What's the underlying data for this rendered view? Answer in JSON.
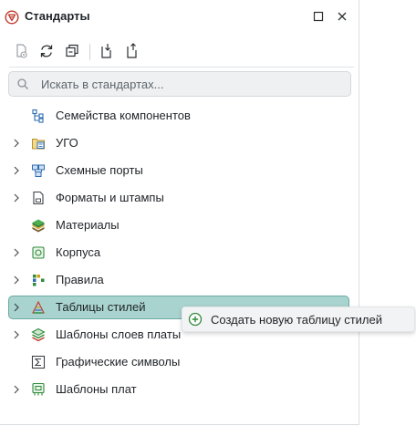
{
  "panel": {
    "title": "Стандарты",
    "icon": "standards-logo-icon"
  },
  "toolbar": {
    "buttons": [
      {
        "name": "document-settings-icon"
      },
      {
        "name": "refresh-icon"
      },
      {
        "name": "collapse-all-icon"
      },
      {
        "name": "import-icon"
      },
      {
        "name": "export-icon"
      }
    ]
  },
  "search": {
    "placeholder": "Искать в стандартах...",
    "value": ""
  },
  "tree": {
    "items": [
      {
        "label": "Семейства компонентов",
        "icon": "component-family-icon",
        "expandable": false
      },
      {
        "label": "УГО",
        "icon": "symbols-icon",
        "expandable": true
      },
      {
        "label": "Схемные порты",
        "icon": "schematic-ports-icon",
        "expandable": true
      },
      {
        "label": "Форматы и штампы",
        "icon": "sheet-formats-icon",
        "expandable": true
      },
      {
        "label": "Материалы",
        "icon": "materials-icon",
        "expandable": false
      },
      {
        "label": "Корпуса",
        "icon": "packages-icon",
        "expandable": true
      },
      {
        "label": "Правила",
        "icon": "rules-icon",
        "expandable": true
      },
      {
        "label": "Таблицы стилей",
        "icon": "style-tables-icon",
        "expandable": true,
        "selected": true
      },
      {
        "label": "Шаблоны слоев платы",
        "icon": "layer-templates-icon",
        "expandable": true
      },
      {
        "label": "Графические символы",
        "icon": "graphic-symbols-icon",
        "expandable": false
      },
      {
        "label": "Шаблоны плат",
        "icon": "board-templates-icon",
        "expandable": true
      }
    ]
  },
  "context_menu": {
    "items": [
      {
        "label": "Создать новую таблицу стилей",
        "icon": "add-circle-icon"
      }
    ]
  },
  "colors": {
    "selection_bg": "#a9d3cf",
    "selection_border": "#6aa9a3",
    "accent_green": "#2f8a3a"
  }
}
